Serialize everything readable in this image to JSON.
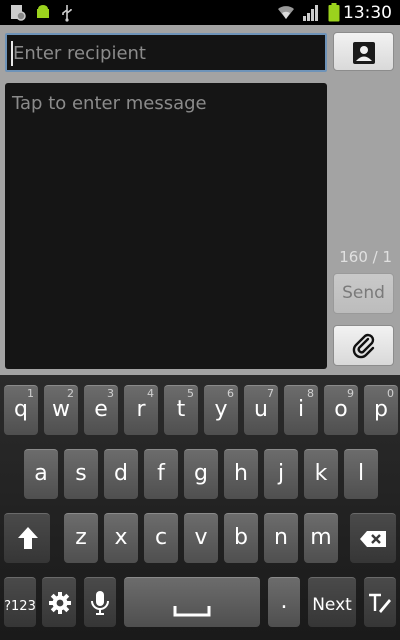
{
  "status_bar": {
    "time": "13:30",
    "icons": [
      "settings-notification-icon",
      "android-icon",
      "usb-icon",
      "wifi-icon",
      "signal-icon",
      "battery-icon"
    ]
  },
  "compose": {
    "recipient_placeholder": "Enter recipient",
    "message_placeholder": "Tap to enter message",
    "char_counter": "160 / 1",
    "send_label": "Send",
    "contact_icon": "contact-icon",
    "attach_icon": "paperclip-icon"
  },
  "keyboard": {
    "row1": [
      {
        "letter": "q",
        "num": "1"
      },
      {
        "letter": "w",
        "num": "2"
      },
      {
        "letter": "e",
        "num": "3"
      },
      {
        "letter": "r",
        "num": "4"
      },
      {
        "letter": "t",
        "num": "5"
      },
      {
        "letter": "y",
        "num": "6"
      },
      {
        "letter": "u",
        "num": "7"
      },
      {
        "letter": "i",
        "num": "8"
      },
      {
        "letter": "o",
        "num": "9"
      },
      {
        "letter": "p",
        "num": "0"
      }
    ],
    "row2": [
      "a",
      "s",
      "d",
      "f",
      "g",
      "h",
      "j",
      "k",
      "l"
    ],
    "row3": [
      "z",
      "x",
      "c",
      "v",
      "b",
      "n",
      "m"
    ],
    "symbols_label": "?123",
    "period_label": ".",
    "next_label": "Next"
  },
  "colors": {
    "compose_background": "#a3a3a3",
    "field_background": "#141414",
    "focus_border": "#6e93b8",
    "key_face": "#5e5e5e",
    "keyboard_background": "#222222"
  }
}
